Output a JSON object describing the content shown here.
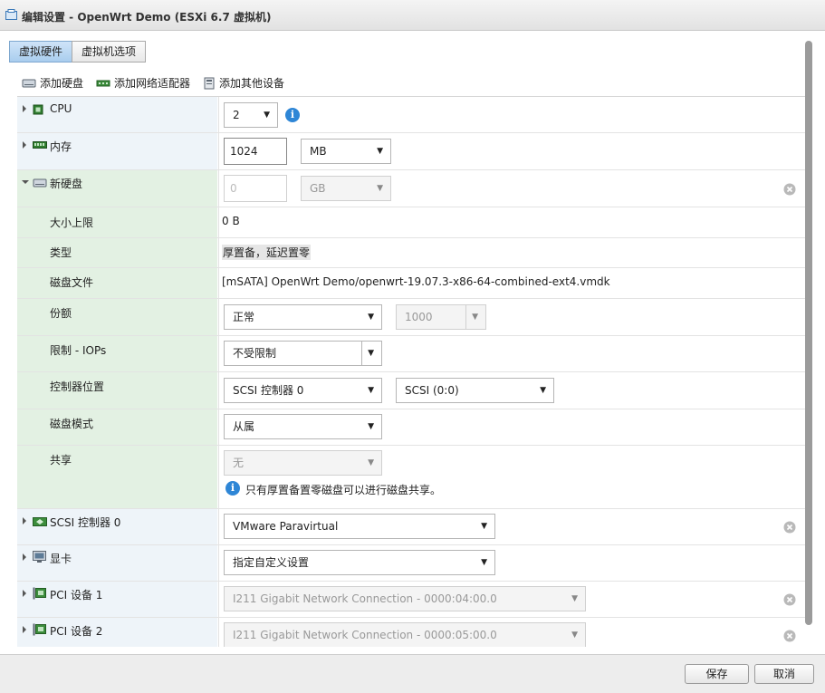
{
  "window": {
    "title": "编辑设置 - OpenWrt Demo (ESXi 6.7 虚拟机)"
  },
  "tabs": [
    {
      "label": "虚拟硬件",
      "active": true
    },
    {
      "label": "虚拟机选项",
      "active": false
    }
  ],
  "add_toolbar": {
    "add_disk": "添加硬盘",
    "add_nic": "添加网络适配器",
    "add_other": "添加其他设备"
  },
  "hardware": {
    "cpu": {
      "label": "CPU",
      "value": "2"
    },
    "memory": {
      "label": "内存",
      "value": "1024",
      "unit": "MB"
    },
    "new_disk": {
      "label": "新硬盘",
      "size": "0",
      "unit": "GB",
      "fields": {
        "max_size": {
          "label": "大小上限",
          "value": "0 B"
        },
        "type": {
          "label": "类型",
          "value": "厚置备，延迟置零"
        },
        "disk_file": {
          "label": "磁盘文件",
          "value": "[mSATA] OpenWrt Demo/openwrt-19.07.3-x86-64-combined-ext4.vmdk"
        },
        "shares": {
          "label": "份额",
          "value": "正常",
          "number": "1000"
        },
        "limit_iops": {
          "label": "限制 - IOPs",
          "value": "不受限制"
        },
        "controller_location": {
          "label": "控制器位置",
          "controller": "SCSI 控制器 0",
          "slot": "SCSI (0:0)"
        },
        "disk_mode": {
          "label": "磁盘模式",
          "value": "从属"
        },
        "sharing": {
          "label": "共享",
          "value": "无",
          "note": "只有厚置备置零磁盘可以进行磁盘共享。"
        }
      }
    },
    "scsi": {
      "label": "SCSI 控制器 0",
      "value": "VMware Paravirtual"
    },
    "video": {
      "label": "显卡",
      "value": "指定自定义设置"
    },
    "pci1": {
      "label": "PCI 设备 1",
      "value": "I211 Gigabit Network Connection - 0000:04:00.0"
    },
    "pci2": {
      "label": "PCI 设备 2",
      "value": "I211 Gigabit Network Connection - 0000:05:00.0"
    }
  },
  "footer": {
    "save": "保存",
    "cancel": "取消"
  },
  "colors": {
    "info_blue": "#2e86d6",
    "tab_active": "#a9cdee",
    "label_bg_blue": "#eef4f9",
    "label_bg_green": "#e3f1e3"
  }
}
